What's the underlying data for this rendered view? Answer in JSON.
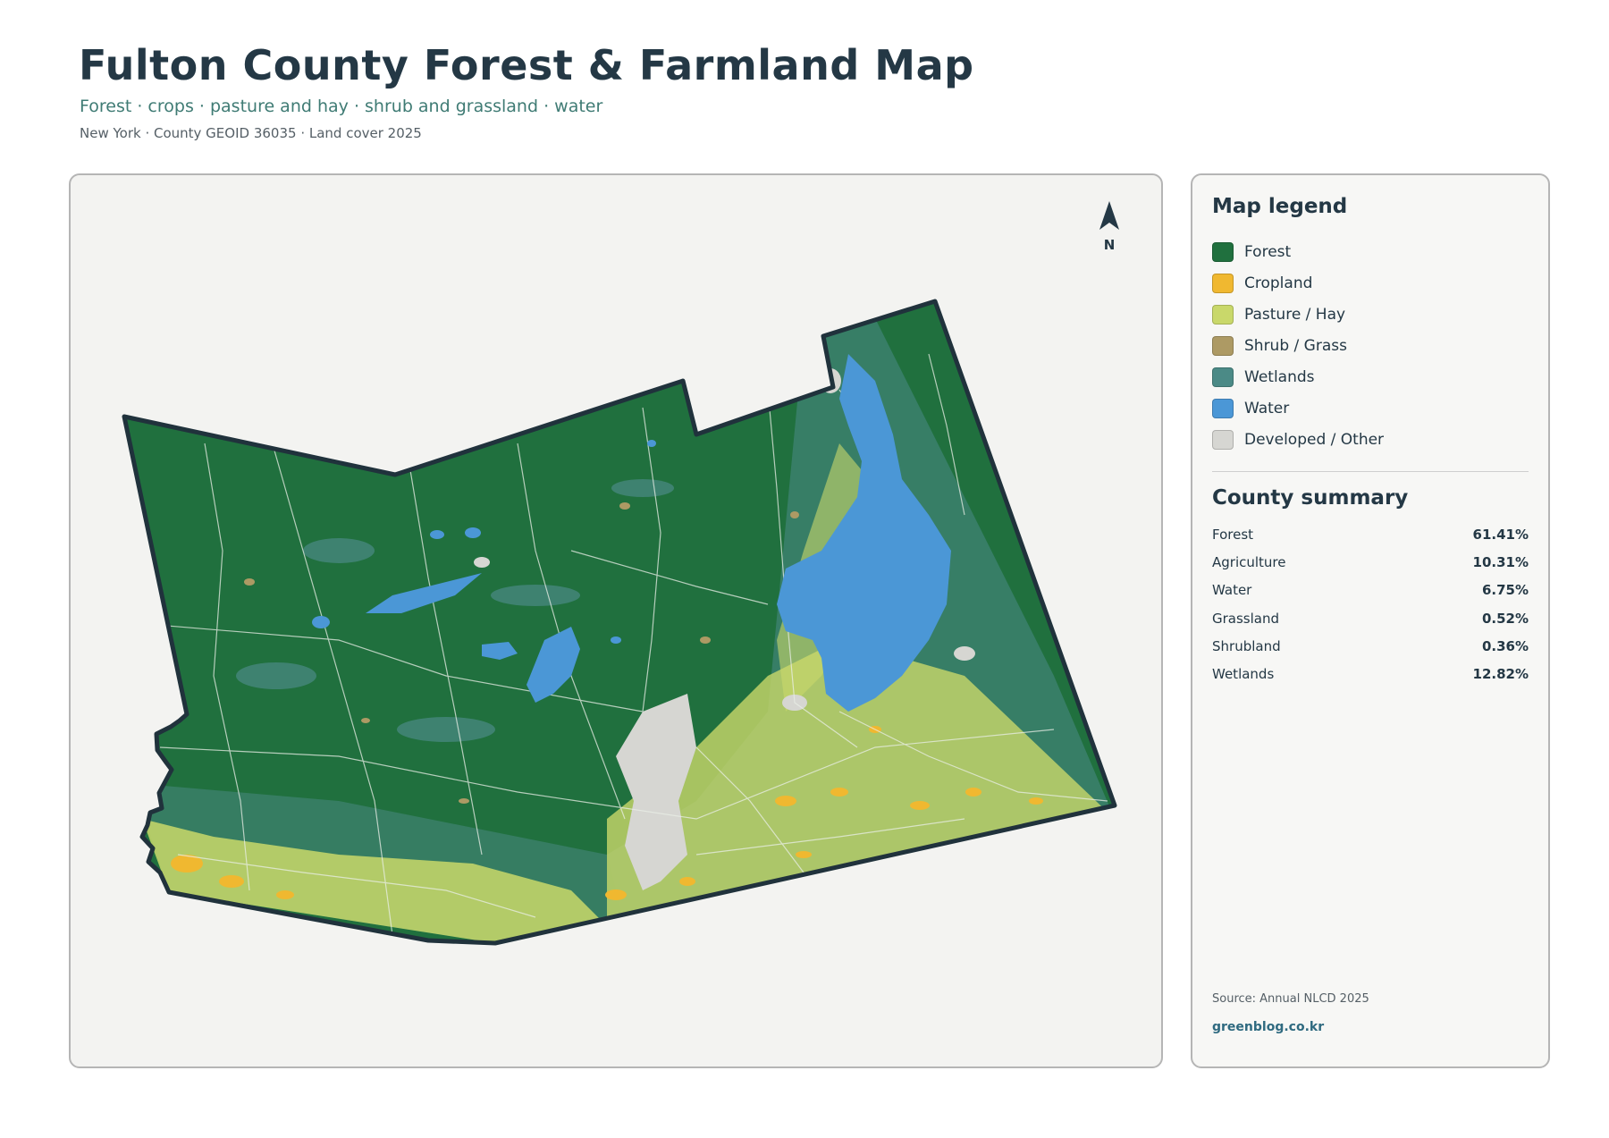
{
  "header": {
    "title": "Fulton County Forest & Farmland Map",
    "subtitle": "Forest · crops · pasture and hay · shrub and grassland · water",
    "meta": "New York · County GEOID 36035 · Land cover 2025"
  },
  "map": {
    "north_label": "N",
    "colors": {
      "forest": "#20703e",
      "cropland": "#f0b830",
      "pasture": "#c9d86a",
      "shrub": "#ad9a64",
      "wetlands": "#4b8a86",
      "water": "#4b97d6",
      "developed": "#d6d6d2",
      "outline": "#20323c"
    }
  },
  "legend": {
    "title": "Map legend",
    "items": [
      {
        "label": "Forest",
        "color": "#20703e"
      },
      {
        "label": "Cropland",
        "color": "#f0b830"
      },
      {
        "label": "Pasture / Hay",
        "color": "#c9d86a"
      },
      {
        "label": "Shrub / Grass",
        "color": "#ad9a64"
      },
      {
        "label": "Wetlands",
        "color": "#4b8a86"
      },
      {
        "label": "Water",
        "color": "#4b97d6"
      },
      {
        "label": "Developed / Other",
        "color": "#d6d6d2"
      }
    ]
  },
  "summary": {
    "title": "County summary",
    "rows": [
      {
        "name": "Forest",
        "value": "61.41%"
      },
      {
        "name": "Agriculture",
        "value": "10.31%"
      },
      {
        "name": "Water",
        "value": "6.75%"
      },
      {
        "name": "Grassland",
        "value": "0.52%"
      },
      {
        "name": "Shrubland",
        "value": "0.36%"
      },
      {
        "name": "Wetlands",
        "value": "12.82%"
      }
    ]
  },
  "footer": {
    "source": "Source: Annual NLCD 2025",
    "credit": "greenblog.co.kr"
  }
}
